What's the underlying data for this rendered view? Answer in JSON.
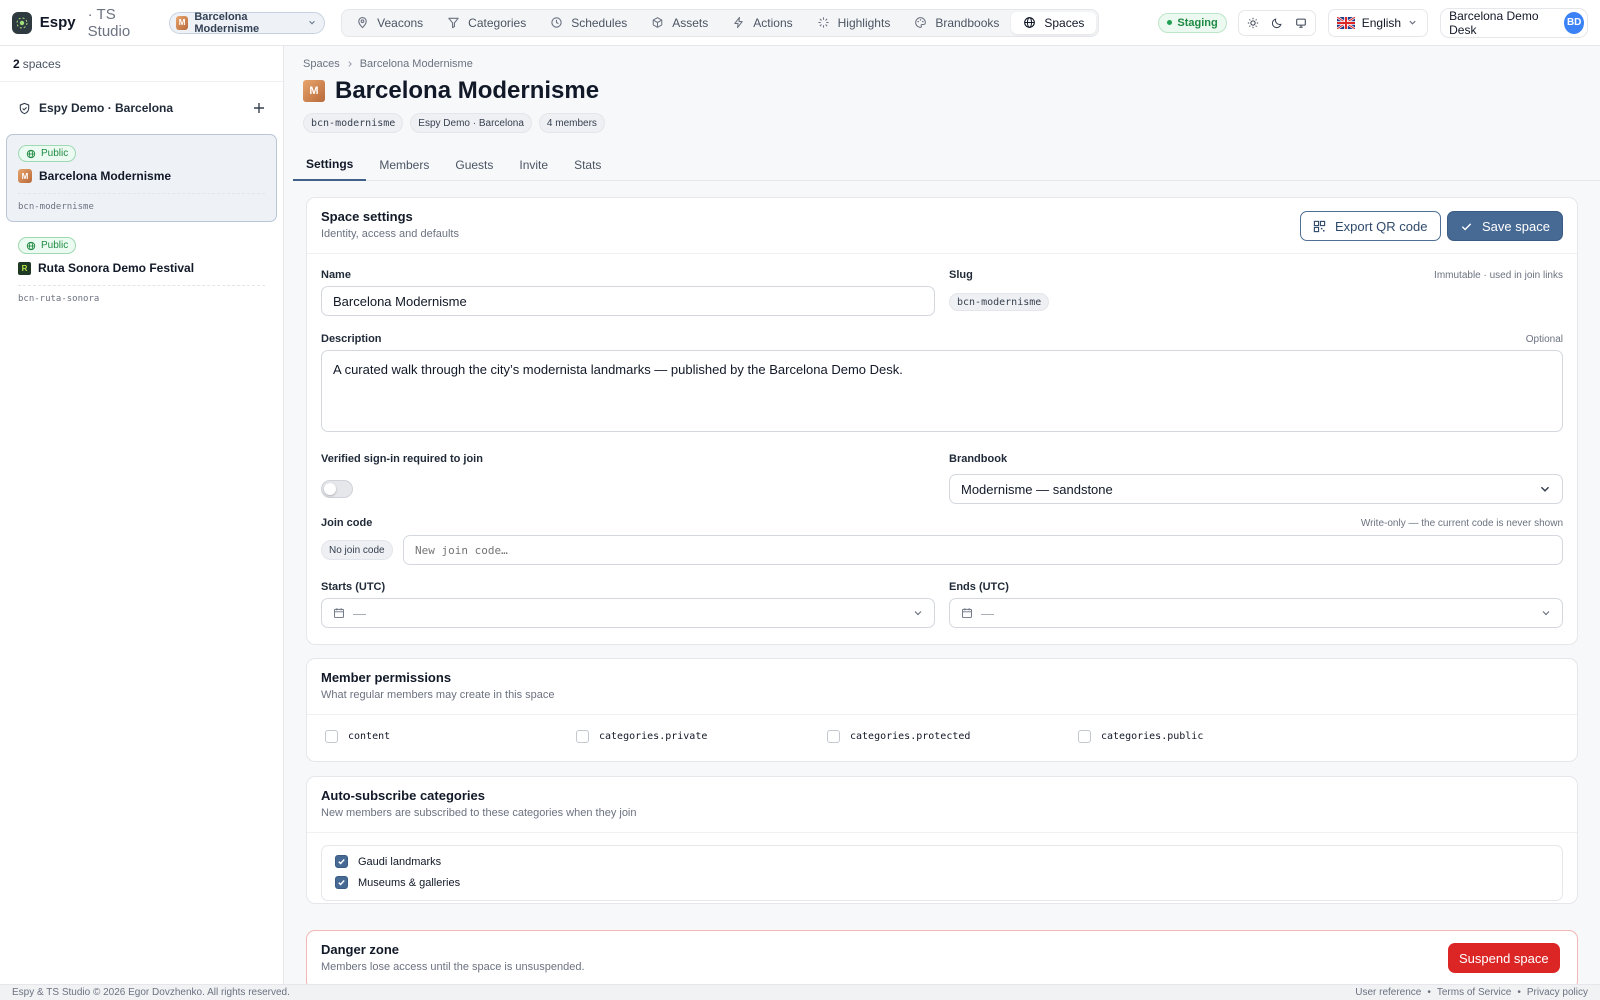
{
  "topbar": {
    "brand": "Espy",
    "brand_sub": "· TS Studio",
    "current_space": "Barcelona Modernisme",
    "current_space_initial": "M",
    "nav": [
      {
        "label": "Veacons",
        "icon": "map-pin-icon"
      },
      {
        "label": "Categories",
        "icon": "filter-icon"
      },
      {
        "label": "Schedules",
        "icon": "clock-icon"
      },
      {
        "label": "Assets",
        "icon": "cube-icon"
      },
      {
        "label": "Actions",
        "icon": "bolt-icon"
      },
      {
        "label": "Highlights",
        "icon": "sparkle-icon"
      },
      {
        "label": "Brandbooks",
        "icon": "palette-icon"
      },
      {
        "label": "Spaces",
        "icon": "globe-icon",
        "active": true
      }
    ],
    "env_badge": "Staging",
    "language": "English",
    "user_name": "Barcelona Demo Desk",
    "user_initials": "BD"
  },
  "sidebar": {
    "count": "2",
    "count_label": "spaces",
    "org": "Espy Demo · Barcelona",
    "spaces": [
      {
        "visibility": "Public",
        "initial": "M",
        "name": "Barcelona Modernisme",
        "slug": "bcn-modernisme",
        "active": true
      },
      {
        "visibility": "Public",
        "initial": "R",
        "name": "Ruta Sonora Demo Festival",
        "slug": "bcn-ruta-sonora",
        "active": false
      }
    ]
  },
  "page": {
    "breadcrumb_root": "Spaces",
    "breadcrumb_current": "Barcelona Modernisme",
    "title_initial": "M",
    "title": "Barcelona Modernisme",
    "chips": [
      "bcn-modernisme",
      "Espy Demo · Barcelona",
      "4 members"
    ],
    "tabs": [
      "Settings",
      "Members",
      "Guests",
      "Invite",
      "Stats"
    ],
    "active_tab": "Settings"
  },
  "settings": {
    "heading": "Space settings",
    "subheading": "Identity, access and defaults",
    "export_label": "Export QR code",
    "save_label": "Save space",
    "name_label": "Name",
    "name_value": "Barcelona Modernisme",
    "slug_label": "Slug",
    "slug_hint": "Immutable · used in join links",
    "slug_value": "bcn-modernisme",
    "description_label": "Description",
    "description_hint": "Optional",
    "description_value": "A curated walk through the city’s modernista landmarks — published by the Barcelona Demo Desk.",
    "verified_label": "Verified sign-in required to join",
    "verified_on": false,
    "brandbook_label": "Brandbook",
    "brandbook_value": "Modernisme — sandstone",
    "joincode_label": "Join code",
    "joincode_hint": "Write-only — the current code is never shown",
    "joincode_badge": "No join code",
    "joincode_placeholder": "New join code…",
    "starts_label": "Starts (UTC)",
    "starts_value": "—",
    "ends_label": "Ends (UTC)",
    "ends_value": "—"
  },
  "permissions": {
    "heading": "Member permissions",
    "subheading": "What regular members may create in this space",
    "items": [
      {
        "label": "content",
        "checked": false
      },
      {
        "label": "categories.private",
        "checked": false
      },
      {
        "label": "categories.protected",
        "checked": false
      },
      {
        "label": "categories.public",
        "checked": false
      }
    ]
  },
  "autosub": {
    "heading": "Auto-subscribe categories",
    "subheading": "New members are subscribed to these categories when they join",
    "items": [
      {
        "label": "Gaudi landmarks",
        "checked": true
      },
      {
        "label": "Museums & galleries",
        "checked": true
      }
    ]
  },
  "danger": {
    "heading": "Danger zone",
    "subheading": "Members lose access until the space is unsuspended.",
    "button": "Suspend space"
  },
  "footer": {
    "copyright": "Espy & TS Studio © 2026 Egor Dovzhenko. All rights reserved.",
    "links": [
      "User reference",
      "Terms of Service",
      "Privacy policy"
    ]
  },
  "colors": {
    "accent": "#476a94",
    "success": "#1f8a43",
    "danger": "#dc2626"
  }
}
